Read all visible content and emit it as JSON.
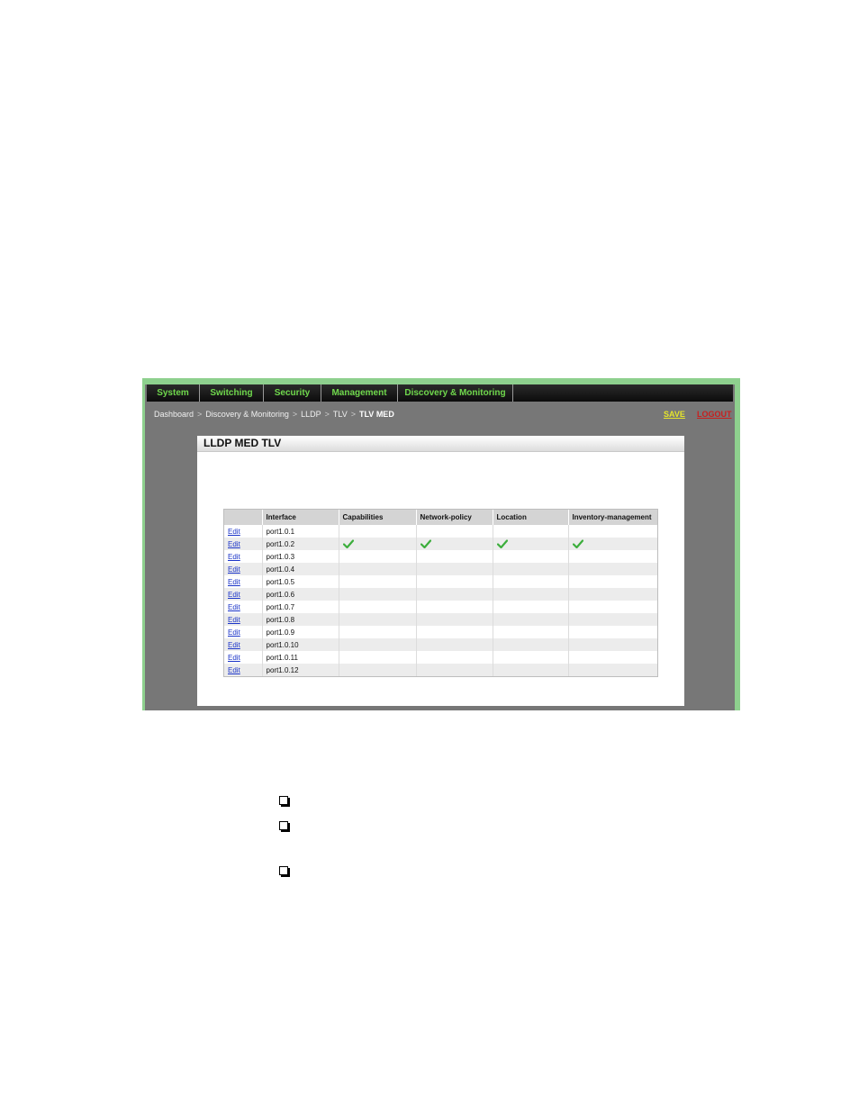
{
  "nav": {
    "tabs": [
      "System",
      "Switching",
      "Security",
      "Management",
      "Discovery & Monitoring"
    ]
  },
  "breadcrumb": [
    "Dashboard",
    "Discovery & Monitoring",
    "LLDP",
    "TLV",
    "TLV MED"
  ],
  "breadcrumb_separator": ">",
  "actions": {
    "save": "SAVE",
    "logout": "LOGOUT"
  },
  "panel": {
    "title": "LLDP MED TLV"
  },
  "table": {
    "columns": [
      "",
      "Interface",
      "Capabilities",
      "Network-policy",
      "Location",
      "Inventory-management"
    ],
    "edit_label": "Edit",
    "rows": [
      {
        "interface": "port1.0.1",
        "capabilities": false,
        "network_policy": false,
        "location": false,
        "inventory": false
      },
      {
        "interface": "port1.0.2",
        "capabilities": true,
        "network_policy": true,
        "location": true,
        "inventory": true
      },
      {
        "interface": "port1.0.3",
        "capabilities": false,
        "network_policy": false,
        "location": false,
        "inventory": false
      },
      {
        "interface": "port1.0.4",
        "capabilities": false,
        "network_policy": false,
        "location": false,
        "inventory": false
      },
      {
        "interface": "port1.0.5",
        "capabilities": false,
        "network_policy": false,
        "location": false,
        "inventory": false
      },
      {
        "interface": "port1.0.6",
        "capabilities": false,
        "network_policy": false,
        "location": false,
        "inventory": false
      },
      {
        "interface": "port1.0.7",
        "capabilities": false,
        "network_policy": false,
        "location": false,
        "inventory": false
      },
      {
        "interface": "port1.0.8",
        "capabilities": false,
        "network_policy": false,
        "location": false,
        "inventory": false
      },
      {
        "interface": "port1.0.9",
        "capabilities": false,
        "network_policy": false,
        "location": false,
        "inventory": false
      },
      {
        "interface": "port1.0.10",
        "capabilities": false,
        "network_policy": false,
        "location": false,
        "inventory": false
      },
      {
        "interface": "port1.0.11",
        "capabilities": false,
        "network_policy": false,
        "location": false,
        "inventory": false
      },
      {
        "interface": "port1.0.12",
        "capabilities": false,
        "network_policy": false,
        "location": false,
        "inventory": false
      }
    ]
  },
  "colors": {
    "nav_text": "#6fd84c",
    "save": "#e6e62a",
    "logout": "#c81e1e",
    "check": "#3cae3c",
    "frame": "#8ed08e"
  },
  "icons": {
    "check": "check-mark-icon",
    "bullet": "checkbox-bullet-icon"
  }
}
